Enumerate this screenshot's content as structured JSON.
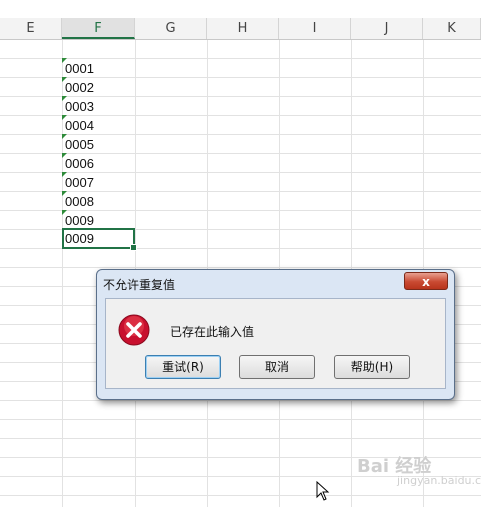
{
  "columns": [
    "E",
    "F",
    "G",
    "H",
    "I",
    "J",
    "K"
  ],
  "active_column": "F",
  "cells": [
    "0001",
    "0002",
    "0003",
    "0004",
    "0005",
    "0006",
    "0007",
    "0008",
    "0009",
    "0009"
  ],
  "selected_cell_index": 9,
  "dialog": {
    "title": "不允许重复值",
    "close_label": "x",
    "message": "已存在此输入值",
    "icon": "error-x-icon",
    "buttons": {
      "retry": "重试(R)",
      "cancel": "取消",
      "help": "帮助(H)"
    }
  },
  "watermark": {
    "text": "Bai 经验",
    "sub": "jingyan.baidu.com"
  },
  "colors": {
    "accent": "#217346",
    "error": "#c8102e",
    "dialog_bg": "#dbe6f4"
  }
}
